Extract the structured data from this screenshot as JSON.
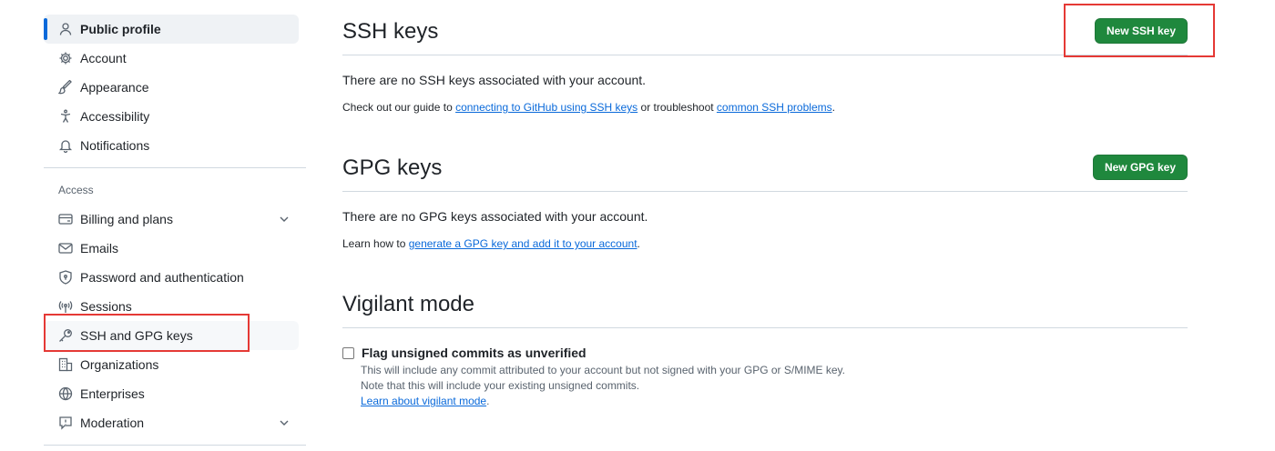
{
  "sidebar": {
    "items_top": [
      {
        "label": "Public profile",
        "icon": "person-icon"
      },
      {
        "label": "Account",
        "icon": "gear-icon"
      },
      {
        "label": "Appearance",
        "icon": "paintbrush-icon"
      },
      {
        "label": "Accessibility",
        "icon": "accessibility-icon"
      },
      {
        "label": "Notifications",
        "icon": "bell-icon"
      }
    ],
    "access_label": "Access",
    "items_access": [
      {
        "label": "Billing and plans",
        "icon": "credit-card-icon"
      },
      {
        "label": "Emails",
        "icon": "mail-icon"
      },
      {
        "label": "Password and authentication",
        "icon": "shield-lock-icon"
      },
      {
        "label": "Sessions",
        "icon": "broadcast-icon"
      },
      {
        "label": "SSH and GPG keys",
        "icon": "key-icon"
      },
      {
        "label": "Organizations",
        "icon": "organization-icon"
      },
      {
        "label": "Enterprises",
        "icon": "globe-icon"
      },
      {
        "label": "Moderation",
        "icon": "report-icon"
      }
    ]
  },
  "ssh": {
    "title": "SSH keys",
    "button": "New SSH key",
    "empty": "There are no SSH keys associated with your account.",
    "note_prefix": "Check out our guide to ",
    "link1": "connecting to GitHub using SSH keys",
    "note_mid": " or troubleshoot ",
    "link2": "common SSH problems",
    "note_end": "."
  },
  "gpg": {
    "title": "GPG keys",
    "button": "New GPG key",
    "empty": "There are no GPG keys associated with your account.",
    "note_prefix": "Learn how to ",
    "link": "generate a GPG key and add it to your account",
    "note_end": "."
  },
  "vigilant": {
    "title": "Vigilant mode",
    "checkbox_label": "Flag unsigned commits as unverified",
    "line1": "This will include any commit attributed to your account but not signed with your GPG or S/MIME key.",
    "line2": "Note that this will include your existing unsigned commits.",
    "link": "Learn about vigilant mode",
    "link_end": "."
  },
  "colors": {
    "accent": "#0969da",
    "primary_button": "#1f883d",
    "highlight": "#e53935"
  }
}
